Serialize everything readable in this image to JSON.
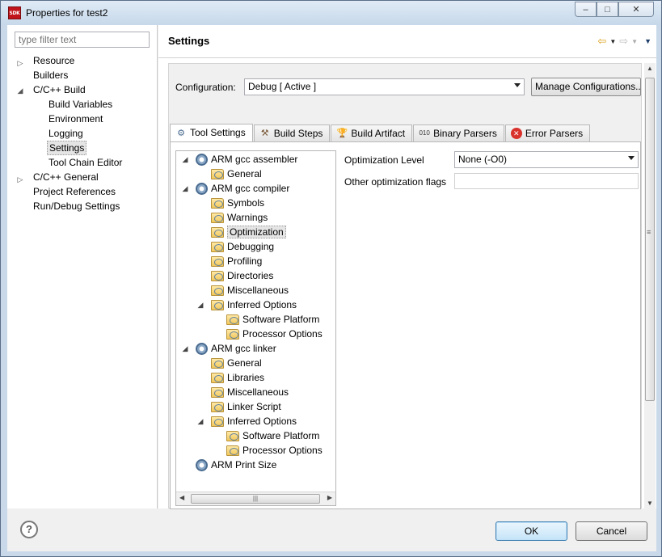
{
  "window": {
    "title": "Properties for test2",
    "app_icon": "sdk-icon",
    "buttons": {
      "minimize": "–",
      "maximize": "□",
      "close": "✕"
    }
  },
  "filter": {
    "placeholder": "type filter text"
  },
  "nav": [
    {
      "label": "Resource",
      "twisty": "▷"
    },
    {
      "label": "Builders"
    },
    {
      "label": "C/C++ Build",
      "twisty": "◢"
    },
    {
      "label": "Build Variables"
    },
    {
      "label": "Environment"
    },
    {
      "label": "Logging"
    },
    {
      "label": "Settings"
    },
    {
      "label": "Tool Chain Editor"
    },
    {
      "label": "C/C++ General",
      "twisty": "▷"
    },
    {
      "label": "Project References"
    },
    {
      "label": "Run/Debug Settings"
    }
  ],
  "header": {
    "title": "Settings"
  },
  "config": {
    "label": "Configuration:",
    "value": "Debug  [ Active ]",
    "manage_label": "Manage Configurations..."
  },
  "tabs": [
    {
      "label": "Tool Settings",
      "icon": "tool-settings-icon"
    },
    {
      "label": "Build Steps",
      "icon": "build-steps-icon"
    },
    {
      "label": "Build Artifact",
      "icon": "build-artifact-icon"
    },
    {
      "label": "Binary Parsers",
      "icon": "binary-parsers-icon"
    },
    {
      "label": "Error Parsers",
      "icon": "error-parsers-icon"
    }
  ],
  "tree": {
    "assembler": "ARM gcc assembler",
    "assembler_general": "General",
    "compiler": "ARM gcc compiler",
    "symbols": "Symbols",
    "warnings": "Warnings",
    "optimization": "Optimization",
    "debugging": "Debugging",
    "profiling": "Profiling",
    "directories": "Directories",
    "miscellaneous": "Miscellaneous",
    "inferred": "Inferred Options",
    "software_platform": "Software Platform",
    "processor_options": "Processor Options",
    "linker": "ARM gcc linker",
    "linker_general": "General",
    "libraries": "Libraries",
    "linker_misc": "Miscellaneous",
    "linker_script": "Linker Script",
    "linker_inferred": "Inferred Options",
    "linker_software_platform": "Software Platform",
    "linker_processor_options": "Processor Options",
    "print_size": "ARM Print Size"
  },
  "options": {
    "optimization_level_label": "Optimization Level",
    "optimization_level_value": "None (-O0)",
    "other_flags_label": "Other optimization flags",
    "other_flags_value": ""
  },
  "buttons": {
    "help": "?",
    "ok": "OK",
    "cancel": "Cancel"
  }
}
